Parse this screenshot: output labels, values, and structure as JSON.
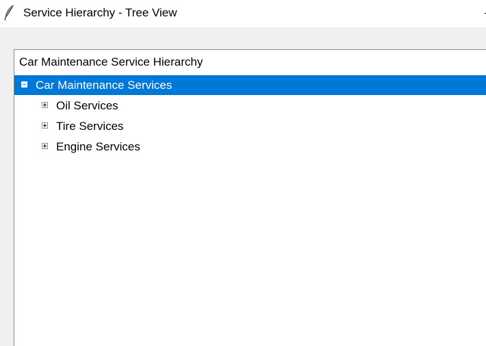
{
  "window": {
    "title": "Service Hierarchy - Tree View",
    "icon": "feather-icon"
  },
  "tree": {
    "heading": "Car Maintenance Service Hierarchy",
    "selection_color": "#0078d7",
    "root": {
      "label": "Car Maintenance Services",
      "expanded": true,
      "selected": true
    },
    "children": [
      {
        "label": "Oil Services",
        "expanded": false
      },
      {
        "label": "Tire Services",
        "expanded": false
      },
      {
        "label": "Engine Services",
        "expanded": false
      }
    ]
  }
}
